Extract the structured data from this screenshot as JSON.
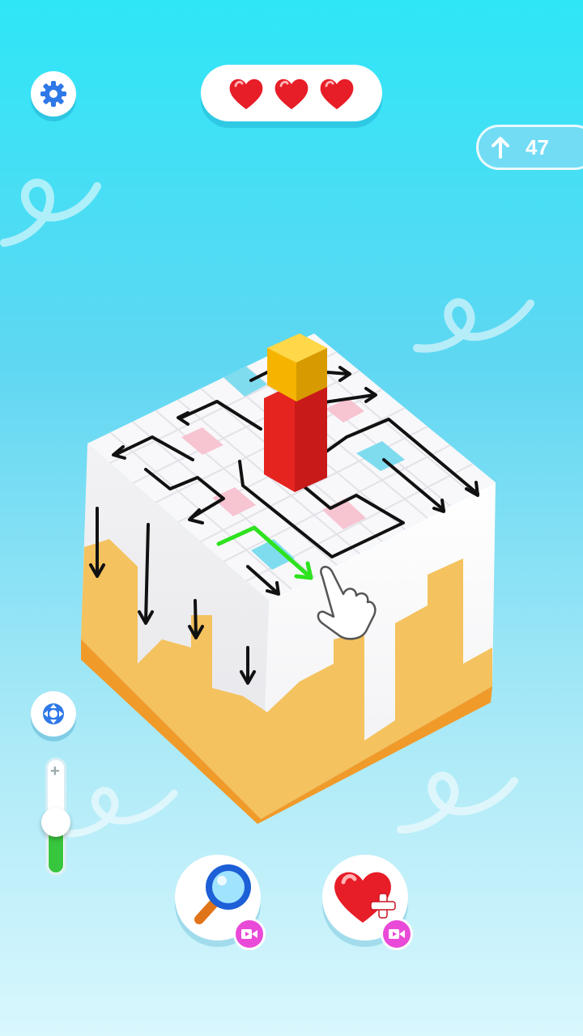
{
  "hud": {
    "settings_icon": "gear-icon",
    "lives": [
      {
        "icon": "heart-icon",
        "filled": true
      },
      {
        "icon": "heart-icon",
        "filled": true
      },
      {
        "icon": "heart-icon",
        "filled": true
      }
    ],
    "moves_icon": "arrow-up-icon",
    "moves_count": "47"
  },
  "controls": {
    "recenter_icon": "recenter-icon",
    "zoom_level": 0.45,
    "zoom_plus_icon": "plus-icon"
  },
  "powerups": [
    {
      "name": "hint",
      "icon": "magnifier-icon",
      "badge_icon": "video-ad-icon"
    },
    {
      "name": "extra-life",
      "icon": "heart-plus-icon",
      "badge_icon": "video-ad-icon"
    }
  ],
  "colors": {
    "background_top": "#2ee6f7",
    "cube_top": "#ffffff",
    "cake_layer": "#f4c25e",
    "cake_base": "#f09a2a",
    "candle": "#e52420",
    "candle_top": "#f6b400",
    "hint_arrow": "#2ee21f",
    "pink_tile": "#f7c4d2",
    "cyan_tile": "#7fdcef",
    "video_badge": "#e94ad8"
  }
}
